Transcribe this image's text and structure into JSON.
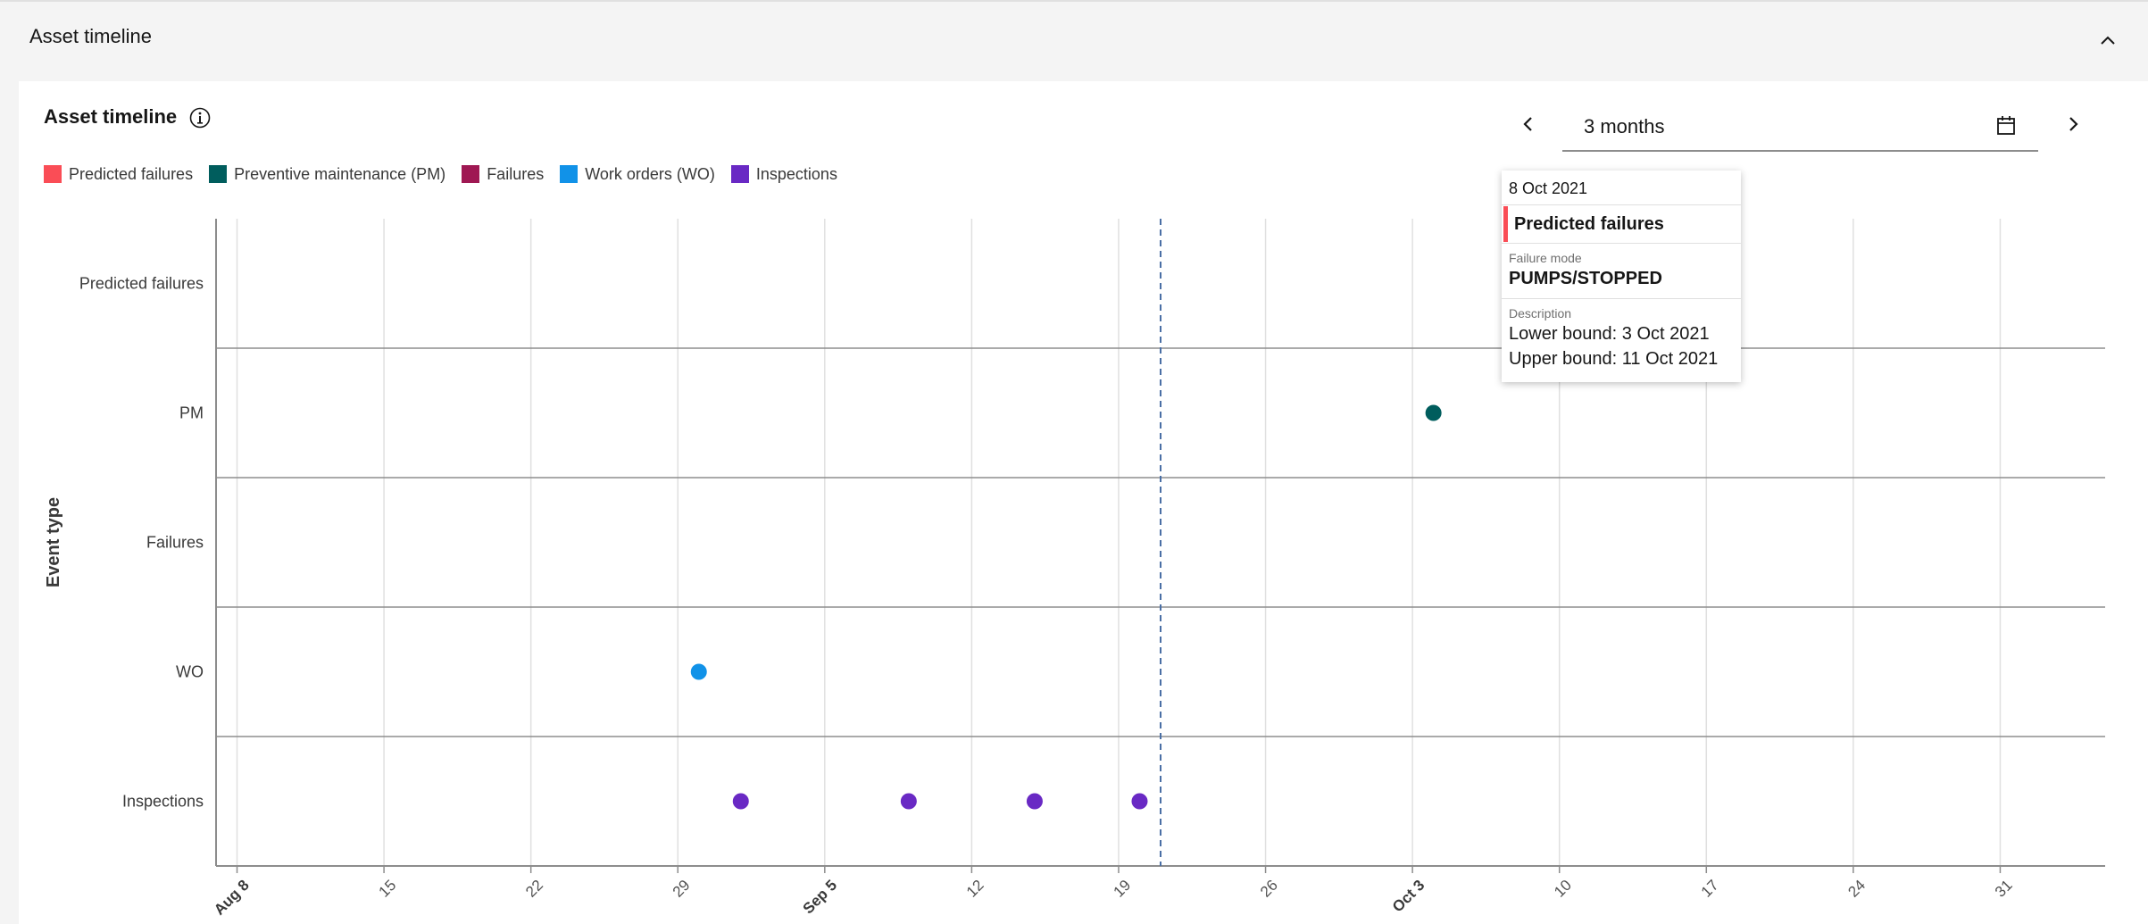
{
  "accordion": {
    "title": "Asset timeline"
  },
  "card": {
    "title": "Asset timeline"
  },
  "range": {
    "value": "3 months"
  },
  "legend": [
    {
      "label": "Predicted failures",
      "color": "#fa4d56"
    },
    {
      "label": "Preventive maintenance (PM)",
      "color": "#005d5d"
    },
    {
      "label": "Failures",
      "color": "#9f1853"
    },
    {
      "label": "Work orders (WO)",
      "color": "#1192e8"
    },
    {
      "label": "Inspections",
      "color": "#6929c4"
    }
  ],
  "tooltip": {
    "date": "8 Oct 2021",
    "title": "Predicted failures",
    "accent_color": "#fa4d56",
    "failure_mode_label": "Failure mode",
    "failure_mode_value": "PUMPS/STOPPED",
    "description_label": "Description",
    "lower_bound": "Lower bound: 3 Oct 2021",
    "upper_bound": "Upper bound: 11 Oct 2021"
  },
  "chart_data": {
    "type": "scatter",
    "ylabel": "Event type",
    "categories": [
      "Predicted failures",
      "PM",
      "Failures",
      "WO",
      "Inspections"
    ],
    "x_range": [
      "2021-08-07",
      "2021-11-05"
    ],
    "x_ticks": [
      {
        "date": "2021-08-08",
        "label": "Aug 8",
        "bold": true
      },
      {
        "date": "2021-08-15",
        "label": "15",
        "bold": false
      },
      {
        "date": "2021-08-22",
        "label": "22",
        "bold": false
      },
      {
        "date": "2021-08-29",
        "label": "29",
        "bold": false
      },
      {
        "date": "2021-09-05",
        "label": "Sep 5",
        "bold": true
      },
      {
        "date": "2021-09-12",
        "label": "12",
        "bold": false
      },
      {
        "date": "2021-09-19",
        "label": "19",
        "bold": false
      },
      {
        "date": "2021-09-26",
        "label": "26",
        "bold": false
      },
      {
        "date": "2021-10-03",
        "label": "Oct 3",
        "bold": true
      },
      {
        "date": "2021-10-10",
        "label": "10",
        "bold": false
      },
      {
        "date": "2021-10-17",
        "label": "17",
        "bold": false
      },
      {
        "date": "2021-10-24",
        "label": "24",
        "bold": false
      },
      {
        "date": "2021-10-31",
        "label": "31",
        "bold": false
      }
    ],
    "reference_line": "2021-09-21",
    "series": [
      {
        "name": "Predicted failures",
        "color": "#fa4d56",
        "points": [
          {
            "date": "2021-10-08",
            "category": "Predicted failures"
          }
        ]
      },
      {
        "name": "Preventive maintenance (PM)",
        "color": "#005d5d",
        "points": [
          {
            "date": "2021-10-04",
            "category": "PM"
          }
        ]
      },
      {
        "name": "Failures",
        "color": "#9f1853",
        "points": []
      },
      {
        "name": "Work orders (WO)",
        "color": "#1192e8",
        "points": [
          {
            "date": "2021-08-30",
            "category": "WO"
          }
        ]
      },
      {
        "name": "Inspections",
        "color": "#6929c4",
        "points": [
          {
            "date": "2021-09-01",
            "category": "Inspections"
          },
          {
            "date": "2021-09-09",
            "category": "Inspections"
          },
          {
            "date": "2021-09-15",
            "category": "Inspections"
          },
          {
            "date": "2021-09-20",
            "category": "Inspections"
          }
        ]
      }
    ]
  }
}
